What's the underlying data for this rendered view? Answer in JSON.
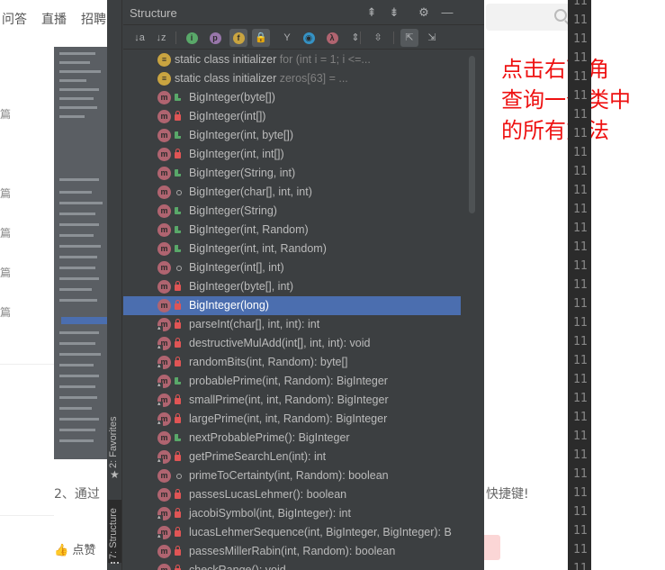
{
  "background_page": {
    "nav": [
      "问答",
      "直播",
      "招聘"
    ],
    "side_labels": [
      "篇",
      "篇",
      "篇",
      "篇",
      "篇"
    ],
    "body_text_left": "2、通过",
    "body_text_right": "快捷键!",
    "like_label": "点赞"
  },
  "annotation": {
    "lines": [
      "点击右下角",
      "查询一个类中",
      "的所有方法"
    ]
  },
  "ide": {
    "panel_title": "Structure",
    "title_icons": [
      "expand-all-icon",
      "collapse-all-icon",
      "gear-icon",
      "minimize-icon"
    ],
    "tool_tabs": {
      "favorites": "2: Favorites",
      "structure": "7: Structure"
    },
    "toolbar": [
      {
        "name": "sort-by-visibility-button",
        "glyph": "↓a",
        "on": false
      },
      {
        "name": "sort-alpha-button",
        "glyph": "↓z",
        "on": false
      },
      {
        "name": "show-inherited-button",
        "glyph": "i",
        "on": false,
        "color": "#59a869"
      },
      {
        "name": "show-properties-button",
        "glyph": "p",
        "on": false,
        "color": "#9876aa"
      },
      {
        "name": "show-fields-button",
        "glyph": "f",
        "on": true,
        "color": "#c9a440"
      },
      {
        "name": "show-non-public-button",
        "glyph": "🔒",
        "on": true
      },
      {
        "name": "show-hierarchy-button",
        "glyph": "Y",
        "on": false
      },
      {
        "name": "show-anonymous-button",
        "glyph": "◉",
        "on": false,
        "color": "#3592c4"
      },
      {
        "name": "show-lambdas-button",
        "glyph": "λ",
        "on": false,
        "color": "#b06470"
      },
      {
        "name": "expand-all-button",
        "glyph": "⇕",
        "on": false
      },
      {
        "name": "collapse-all-button",
        "glyph": "⇳",
        "on": false
      },
      {
        "name": "autoscroll-to-source-button",
        "glyph": "⇱",
        "on": true
      },
      {
        "name": "autoscroll-from-source-button",
        "glyph": "⇲",
        "on": false
      }
    ],
    "members": [
      {
        "kind": "static",
        "label": "static class initializer ",
        "detail": "for (int i = 1; i <=...",
        "vis": ""
      },
      {
        "kind": "static",
        "label": "static class initializer ",
        "detail": "zeros[63] =          ...",
        "vis": ""
      },
      {
        "kind": "m",
        "label": "BigInteger(byte[])",
        "vis": "pub"
      },
      {
        "kind": "m",
        "label": "BigInteger(int[])",
        "vis": "priv"
      },
      {
        "kind": "m",
        "label": "BigInteger(int, byte[])",
        "vis": "pub"
      },
      {
        "kind": "m",
        "label": "BigInteger(int, int[])",
        "vis": "priv"
      },
      {
        "kind": "m",
        "label": "BigInteger(String, int)",
        "vis": "pub"
      },
      {
        "kind": "m",
        "label": "BigInteger(char[], int, int)",
        "vis": "pkg"
      },
      {
        "kind": "m",
        "label": "BigInteger(String)",
        "vis": "pub"
      },
      {
        "kind": "m",
        "label": "BigInteger(int, Random)",
        "vis": "pub"
      },
      {
        "kind": "m",
        "label": "BigInteger(int, int, Random)",
        "vis": "pub"
      },
      {
        "kind": "m",
        "label": "BigInteger(int[], int)",
        "vis": "pkg"
      },
      {
        "kind": "m",
        "label": "BigInteger(byte[], int)",
        "vis": "priv"
      },
      {
        "kind": "m",
        "label": "BigInteger(long)",
        "vis": "priv",
        "selected": true
      },
      {
        "kind": "m",
        "label": "parseInt(char[], int, int): int",
        "vis": "priv",
        "static": true
      },
      {
        "kind": "m",
        "label": "destructiveMulAdd(int[], int, int): void",
        "vis": "priv",
        "static": true
      },
      {
        "kind": "m",
        "label": "randomBits(int, Random): byte[]",
        "vis": "priv",
        "static": true
      },
      {
        "kind": "m",
        "label": "probablePrime(int, Random): BigInteger",
        "vis": "pub",
        "static": true
      },
      {
        "kind": "m",
        "label": "smallPrime(int, int, Random): BigInteger",
        "vis": "priv",
        "static": true
      },
      {
        "kind": "m",
        "label": "largePrime(int, int, Random): BigInteger",
        "vis": "priv",
        "static": true
      },
      {
        "kind": "m",
        "label": "nextProbablePrime(): BigInteger",
        "vis": "pub"
      },
      {
        "kind": "m",
        "label": "getPrimeSearchLen(int): int",
        "vis": "priv",
        "static": true
      },
      {
        "kind": "m",
        "label": "primeToCertainty(int, Random): boolean",
        "vis": "pkg"
      },
      {
        "kind": "m",
        "label": "passesLucasLehmer(): boolean",
        "vis": "priv"
      },
      {
        "kind": "m",
        "label": "jacobiSymbol(int, BigInteger): int",
        "vis": "priv",
        "static": true
      },
      {
        "kind": "m",
        "label": "lucasLehmerSequence(int, BigInteger, BigInteger): B",
        "vis": "priv",
        "static": true
      },
      {
        "kind": "m",
        "label": "passesMillerRabin(int, Random): boolean",
        "vis": "priv"
      },
      {
        "kind": "m",
        "label": "checkRange(): void",
        "vis": "priv"
      }
    ],
    "gutter_numbers": [
      "11",
      "11",
      "11",
      "11",
      "11",
      "11",
      "11",
      "11",
      "11",
      "11",
      "11",
      "11",
      "11",
      "11",
      "11",
      "11",
      "11",
      "11",
      "11",
      "11",
      "11",
      "11",
      "11",
      "11",
      "11",
      "11",
      "11",
      "11",
      "11",
      "11",
      "11"
    ]
  }
}
